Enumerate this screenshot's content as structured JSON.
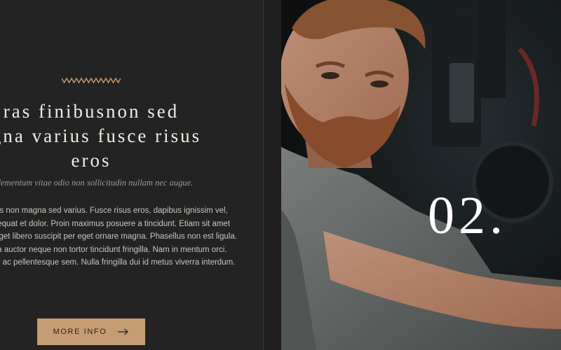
{
  "slide": {
    "heading": "ras finibusnon sed agna varius fusce risus eros",
    "subtitle": "dementum vitae odio non sollicitudin nullam nec augue.",
    "body": "inibus non magna sed varius. Fusce risus eros, dapibus ignissim vel, consequat et dolor. Proin maximus posuere a tincidunt. Etiam sit amet ligula eget libero suscipit per eget ornare magna. Phasellus non est ligula. Nulla auctor neque non tortor tincidunt fringilla. Nam in mentum orci. Integer ac pellentesque sem. Nulla fringilla dui id metus viverra interdum.",
    "button_label": "MORE INFO",
    "number": "02."
  },
  "colors": {
    "panel_bg": "#242323",
    "accent": "#c59d72",
    "heading_text": "#f1ece3",
    "body_text": "#c9c5be"
  },
  "icons": [
    "zigzag-ornament-icon",
    "arrow-right-icon"
  ]
}
